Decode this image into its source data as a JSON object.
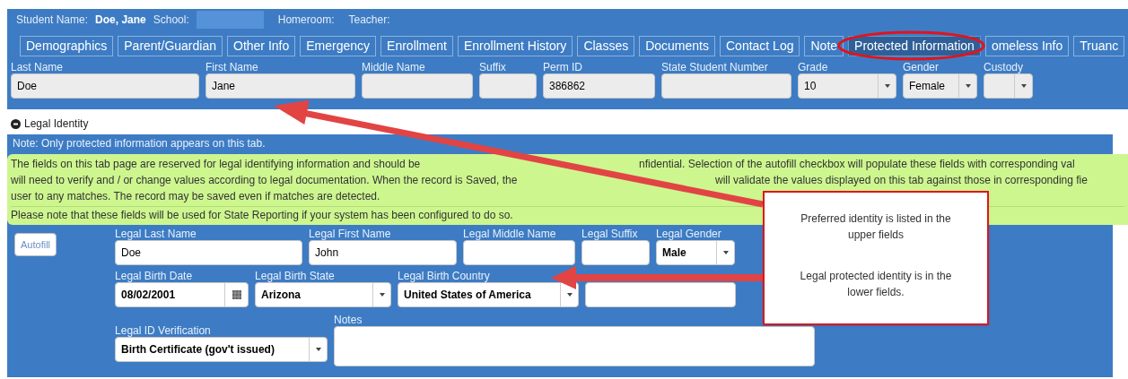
{
  "header": {
    "student_label": "Student Name:",
    "student_name": "Doe, Jane",
    "school_label": "School:",
    "homeroom_label": "Homeroom:",
    "teacher_label": "Teacher:"
  },
  "tabs": [
    {
      "label": "Demographics",
      "selected": false
    },
    {
      "label": "Parent/Guardian",
      "selected": false
    },
    {
      "label": "Other Info",
      "selected": false
    },
    {
      "label": "Emergency",
      "selected": false
    },
    {
      "label": "Enrollment",
      "selected": false
    },
    {
      "label": "Enrollment History",
      "selected": false
    },
    {
      "label": "Classes",
      "selected": false
    },
    {
      "label": "Documents",
      "selected": false
    },
    {
      "label": "Contact Log",
      "selected": false
    },
    {
      "label": "Note",
      "selected": false
    },
    {
      "label": "Protected Information",
      "selected": true
    },
    {
      "label": "omeless Info",
      "selected": false
    },
    {
      "label": "Truanc",
      "selected": false
    }
  ],
  "student_fields": [
    {
      "label": "Last Name",
      "value": "Doe",
      "kind": "text"
    },
    {
      "label": "First Name",
      "value": "Jane",
      "kind": "text"
    },
    {
      "label": "Middle Name",
      "kind": "text"
    },
    {
      "label": "Suffix",
      "kind": "text"
    },
    {
      "label": "Perm ID",
      "value": "386862",
      "kind": "text"
    },
    {
      "label": "State Student Number",
      "kind": "text"
    },
    {
      "label": "Grade",
      "value": "10",
      "kind": "select"
    },
    {
      "label": "Gender",
      "value": "Female",
      "kind": "select"
    },
    {
      "label": "Custody",
      "kind": "select"
    }
  ],
  "section": {
    "title": "Legal Identity",
    "expanded": true
  },
  "note": "Note: Only protected information appears on this tab.",
  "info_lines": [
    [
      "The fields on this tab page are reserved for legal identifying information and should be",
      "nfidential. Selection of the autofill checkbox will populate these fields with corresponding val"
    ],
    [
      "will need to verify and / or change values according to legal documentation. When the record is Saved, the",
      "will validate the values displayed on this tab against those in corresponding fie"
    ],
    [
      "user to any matches. The record may be saved even if matches are detected."
    ]
  ],
  "info_footer": "Please note that these fields will be used for State Reporting if your system has been configured to do so.",
  "autofill_button": "Autofill",
  "legal_rows": [
    [
      {
        "label": "Legal Last Name",
        "value": "Doe",
        "kind": "text"
      },
      {
        "label": "Legal First Name",
        "value": "John",
        "kind": "text"
      },
      {
        "label": "Legal Middle Name",
        "kind": "text"
      },
      {
        "label": "Legal Suffix",
        "kind": "text"
      },
      {
        "label": "Legal Gender",
        "value": "Male",
        "kind": "select"
      }
    ],
    [
      {
        "label": "Legal Birth Date",
        "value": "08/02/2001",
        "kind": "date"
      },
      {
        "label": "Legal Birth State",
        "value": "Arizona",
        "kind": "select"
      },
      {
        "label": "Legal Birth Country",
        "value": "United States of America",
        "kind": "select"
      },
      {
        "kind": "text"
      }
    ],
    [
      {
        "label": "Legal ID Verification",
        "value": "Birth Certificate (gov't issued)",
        "kind": "select"
      },
      {
        "label": "Notes",
        "kind": "textarea"
      }
    ]
  ],
  "callout": {
    "lines": [
      "Preferred identity is listed in the upper fields",
      "Legal protected identity is in the lower fields."
    ]
  }
}
